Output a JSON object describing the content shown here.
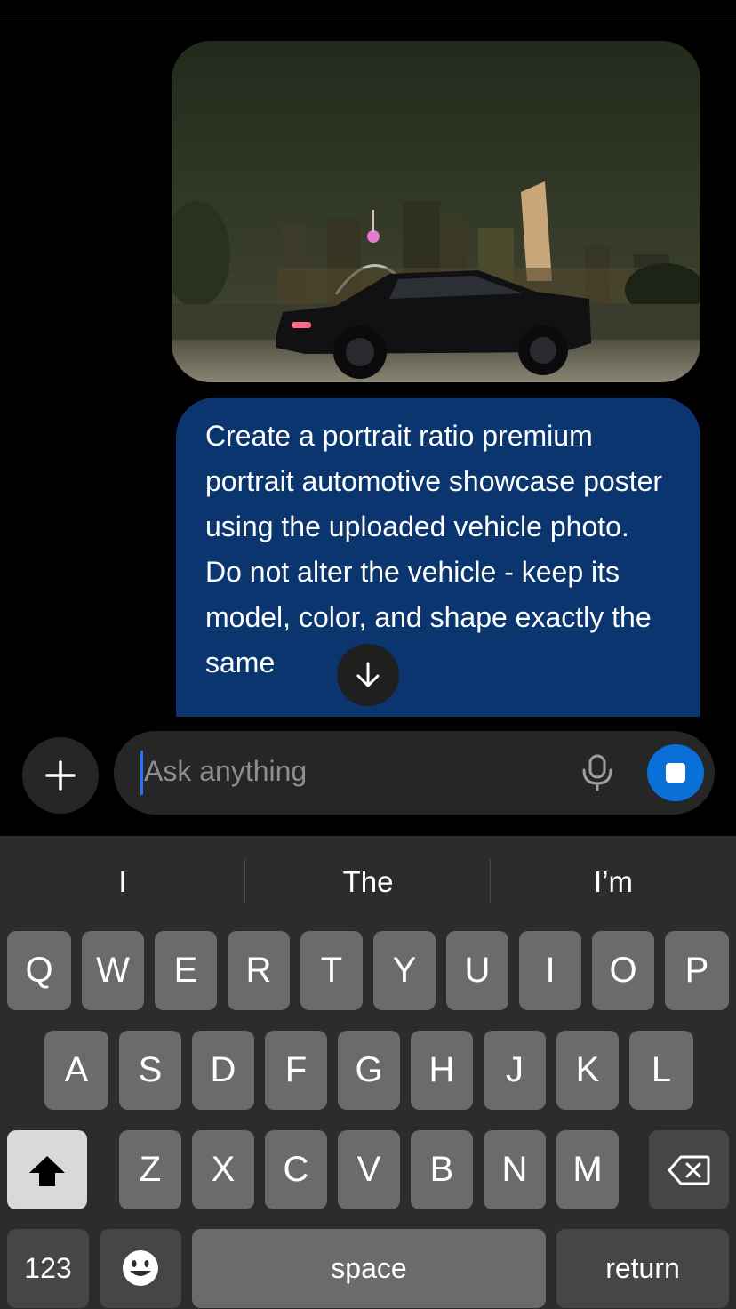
{
  "conversation": {
    "image": {
      "description_icon": "car-photo"
    },
    "message": "Create a portrait ratio premium portrait automotive showcase poster using the uploaded vehicle photo.\nDo not alter the vehicle - keep its model, color, and shape exactly the same"
  },
  "composer": {
    "placeholder": "Ask anything",
    "plus_icon": "plus-icon",
    "mic_icon": "microphone-icon",
    "stop_icon": "stop-icon"
  },
  "keyboard": {
    "suggestions": [
      "I",
      "The",
      "I’m"
    ],
    "row1": [
      "Q",
      "W",
      "E",
      "R",
      "T",
      "Y",
      "U",
      "I",
      "O",
      "P"
    ],
    "row2": [
      "A",
      "S",
      "D",
      "F",
      "G",
      "H",
      "J",
      "K",
      "L"
    ],
    "row3": [
      "Z",
      "X",
      "C",
      "V",
      "B",
      "N",
      "M"
    ],
    "numbers_label": "123",
    "space_label": "space",
    "return_label": "return"
  },
  "colors": {
    "bubble": "#0a356e",
    "accent": "#0b6fd8",
    "keyboard_bg": "#2c2c2e"
  }
}
